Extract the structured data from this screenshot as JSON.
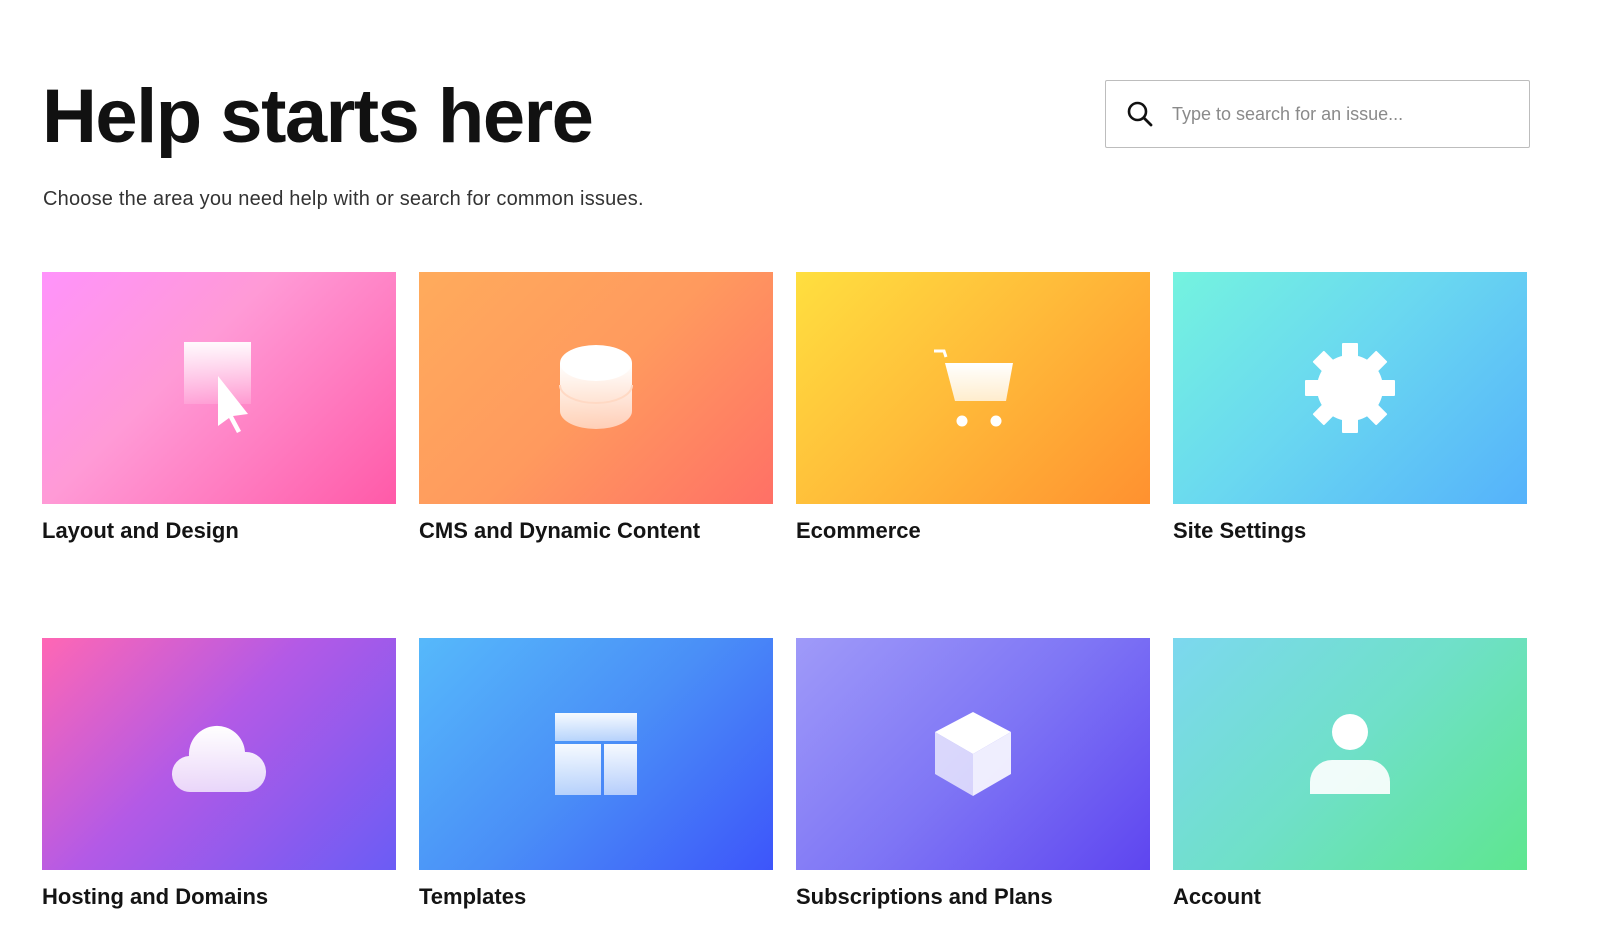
{
  "header": {
    "title": "Help starts here",
    "subtitle": "Choose the area you need help with or search for common issues."
  },
  "search": {
    "placeholder": "Type to search for an issue...",
    "icon": "search-icon"
  },
  "categories": [
    {
      "label": "Layout and Design",
      "icon": "cursor-icon",
      "colors": [
        "#ff93fb",
        "#ff5aa8"
      ]
    },
    {
      "label": "CMS and Dynamic Content",
      "icon": "database-icon",
      "colors": [
        "#ffab5c",
        "#ff7066"
      ]
    },
    {
      "label": "Ecommerce",
      "icon": "cart-icon",
      "colors": [
        "#ffdf3f",
        "#ff9130"
      ]
    },
    {
      "label": "Site Settings",
      "icon": "gear-icon",
      "colors": [
        "#74f3df",
        "#55b2fb"
      ]
    },
    {
      "label": "Hosting and Domains",
      "icon": "cloud-icon",
      "colors": [
        "#ff67b4",
        "#6b5cf5"
      ]
    },
    {
      "label": "Templates",
      "icon": "template-icon",
      "colors": [
        "#56b9fb",
        "#3d55fa"
      ]
    },
    {
      "label": "Subscriptions and Plans",
      "icon": "cube-icon",
      "colors": [
        "#9f9af9",
        "#5e45f0"
      ]
    },
    {
      "label": "Account",
      "icon": "user-icon",
      "colors": [
        "#7cd8ef",
        "#5ee68f"
      ]
    }
  ]
}
